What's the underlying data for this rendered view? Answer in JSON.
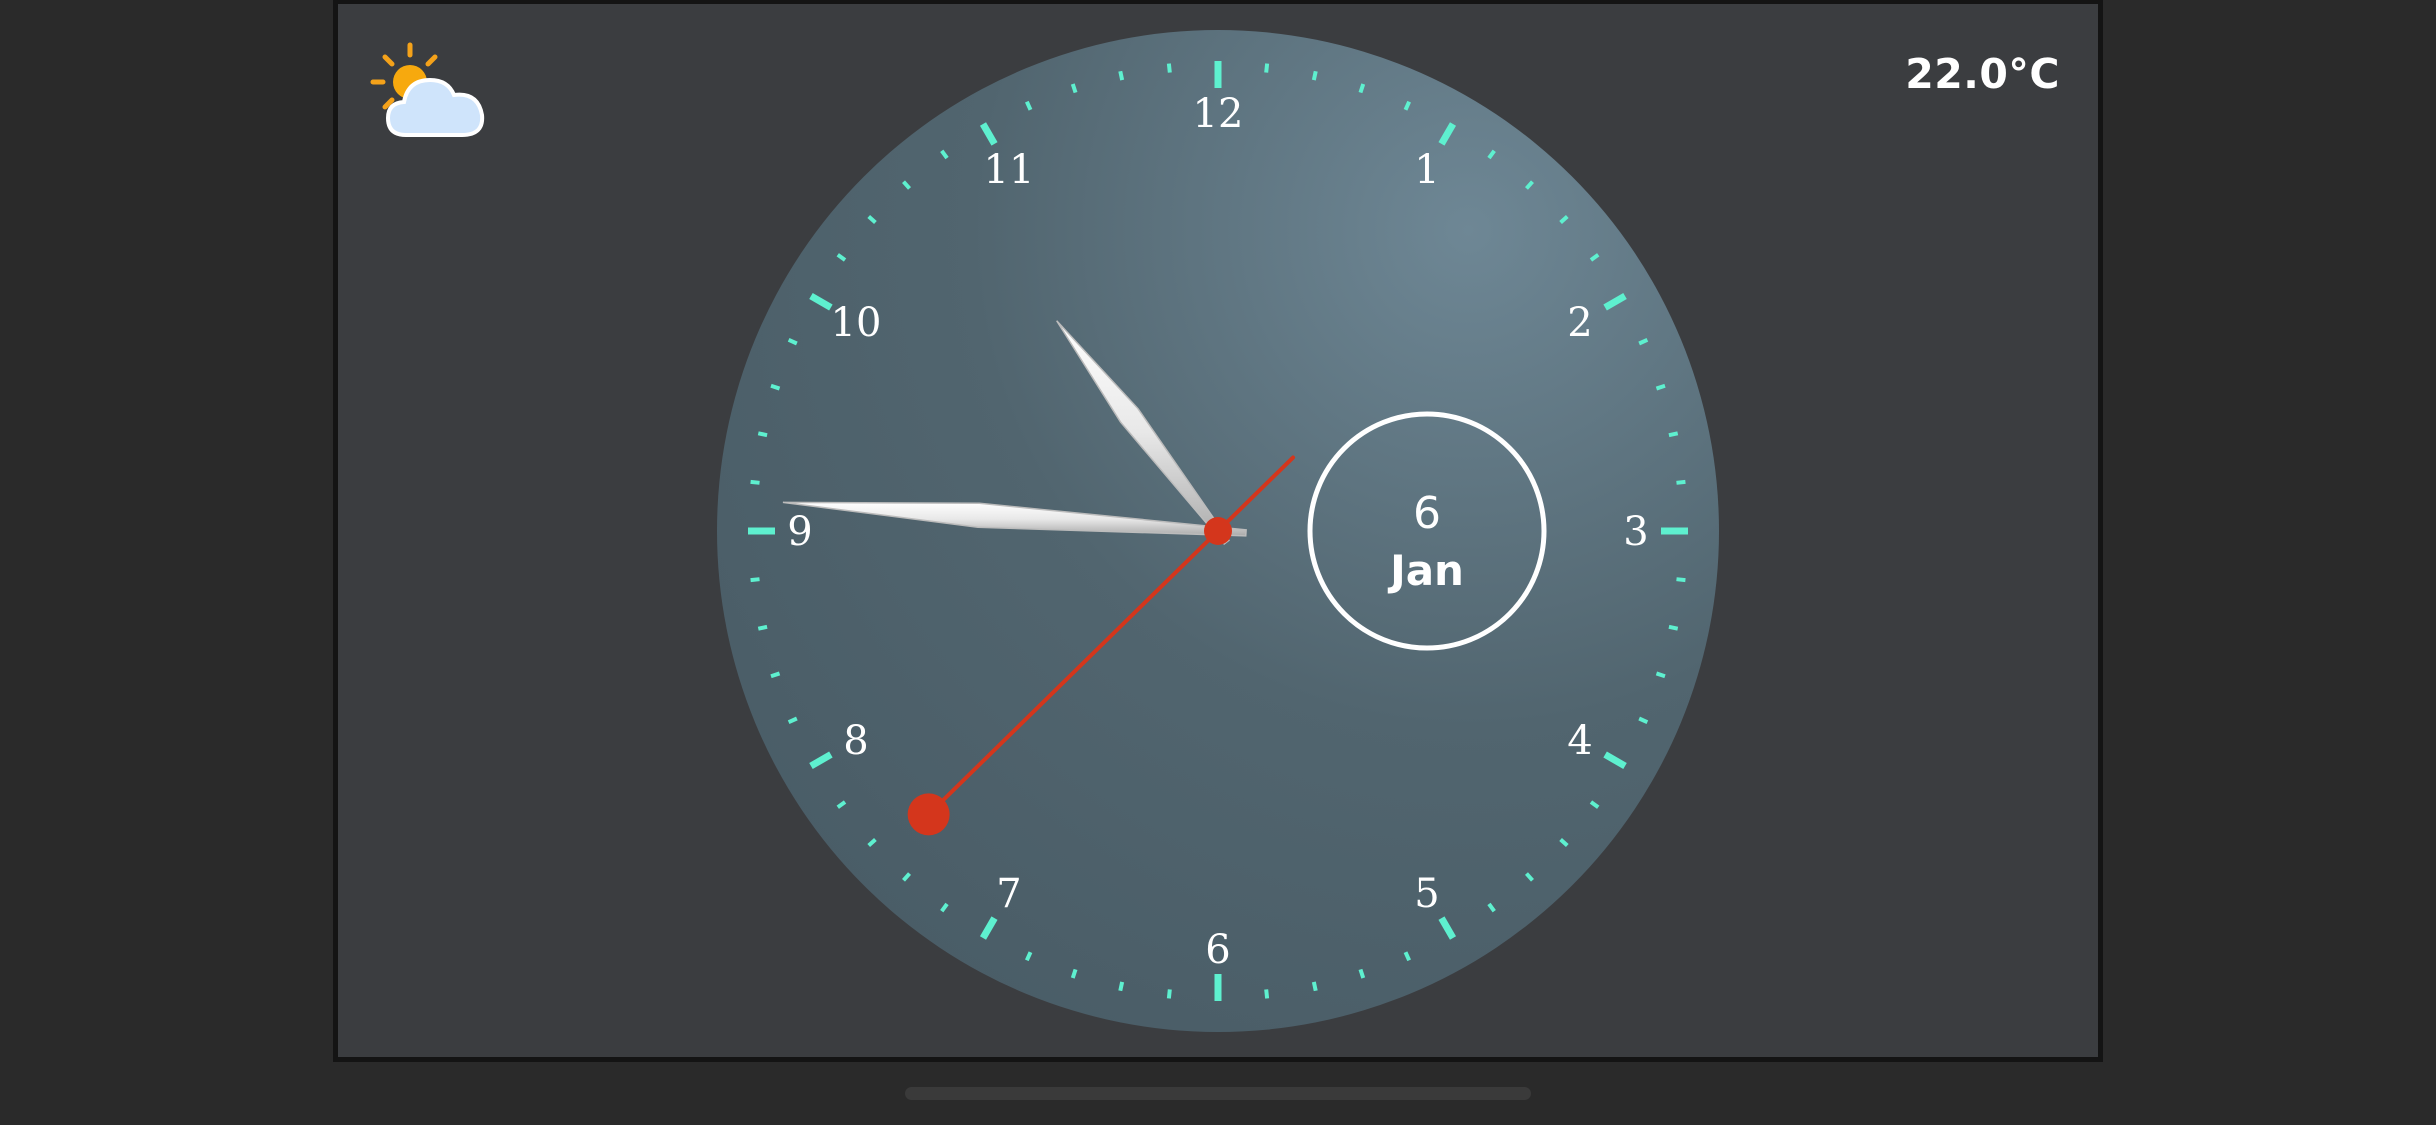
{
  "weather": {
    "icon": "partly-cloudy-icon",
    "temperature": "22.0°C"
  },
  "clock": {
    "numerals": [
      "12",
      "1",
      "2",
      "3",
      "4",
      "5",
      "6",
      "7",
      "8",
      "9",
      "10",
      "11"
    ],
    "date_day": "6",
    "date_month": "Jan",
    "accent_color": "#5ef0cf",
    "second_hand_color": "#d4361c",
    "time": {
      "hour": 10,
      "minute": 45,
      "second": 37.6
    }
  }
}
